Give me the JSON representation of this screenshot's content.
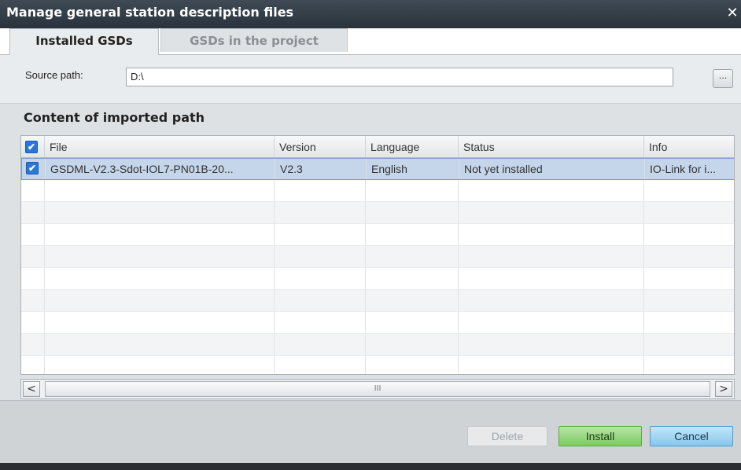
{
  "window": {
    "title": "Manage general station description files",
    "close_symbol": "✕"
  },
  "tabs": [
    {
      "label": "Installed GSDs",
      "active": true
    },
    {
      "label": "GSDs in the project",
      "active": false
    }
  ],
  "source": {
    "label": "Source path:",
    "value": "D:\\",
    "browse_label": "..."
  },
  "content": {
    "title": "Content of imported path",
    "columns": [
      "File",
      "Version",
      "Language",
      "Status",
      "Info"
    ],
    "rows": [
      {
        "checked": true,
        "file": "GSDML-V2.3-Sdot-IOL7-PN01B-20...",
        "version": "V2.3",
        "language": "English",
        "status": "Not yet installed",
        "info": "IO-Link for i..."
      }
    ],
    "check_glyph": "✔"
  },
  "scrollbar": {
    "left_arrow": "<",
    "right_arrow": ">",
    "thumb_grip": "III"
  },
  "buttons": {
    "delete": "Delete",
    "install": "Install",
    "cancel": "Cancel"
  },
  "colors": {
    "title_bar": "#2f3941",
    "install_button": "#86cf6c",
    "cancel_button": "#8ccbf0",
    "selection": "#c5d5ea",
    "checkbox": "#2a77d6"
  }
}
